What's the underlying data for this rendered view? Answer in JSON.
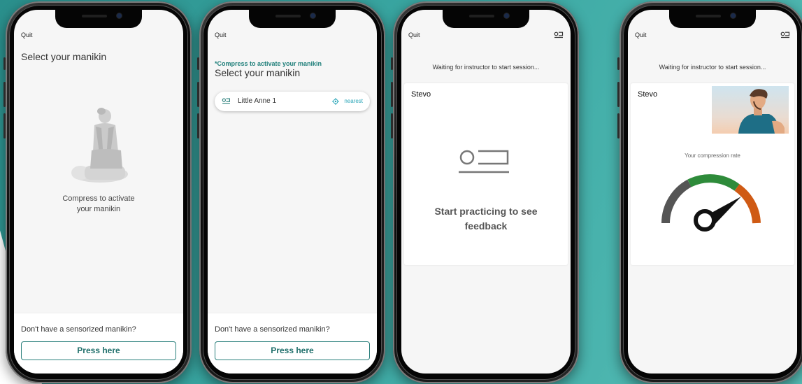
{
  "colors": {
    "accent": "#2a7f7b",
    "hint_text": "#1f7f7a",
    "nearest": "#2aa6b8",
    "gauge_low": "#555555",
    "gauge_mid": "#2e8b3a",
    "gauge_high": "#cf5a14"
  },
  "screen1": {
    "quit": "Quit",
    "title": "Select your manikin",
    "compress_line1": "Compress to activate",
    "compress_line2": "your manikin",
    "no_manikin": "Don't have a sensorized manikin?",
    "press_here": "Press here"
  },
  "screen2": {
    "quit": "Quit",
    "compress_hint": "*Compress to activate your manikin",
    "title": "Select your manikin",
    "manikin_label": "Little Anne 1",
    "nearest": "nearest",
    "no_manikin": "Don't have a sensorized manikin?",
    "press_here": "Press here"
  },
  "screen3": {
    "quit": "Quit",
    "waiting": "Waiting for instructor to start session...",
    "card_name": "Stevo",
    "feedback_line1": "Start practicing to see",
    "feedback_line2": "feedback"
  },
  "screen4": {
    "quit": "Quit",
    "waiting": "Waiting for instructor to start session...",
    "card_name": "Stevo",
    "rate_label": "Your compression rate"
  }
}
